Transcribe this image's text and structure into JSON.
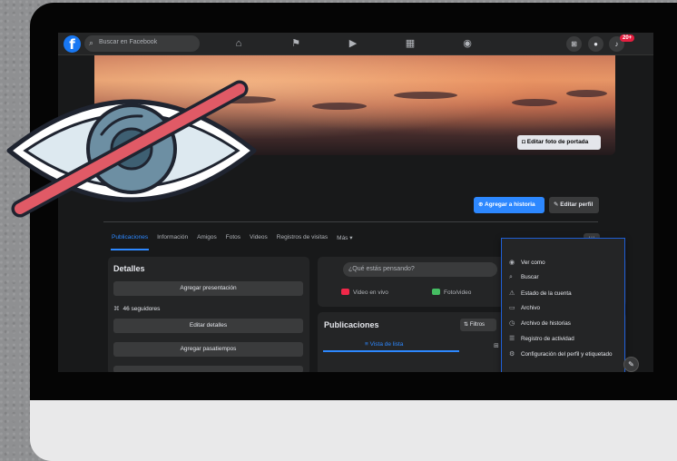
{
  "topbar": {
    "logo_letter": "f",
    "search_placeholder": "Buscar en Facebook",
    "notifications_count": "20+"
  },
  "cover": {
    "edit_cover_label": "Editar foto de portada"
  },
  "profile_actions": {
    "add_story_label": "Agregar a historia",
    "edit_profile_label": "Editar perfil"
  },
  "tabs": [
    {
      "label": "Publicaciones",
      "active": true
    },
    {
      "label": "Información"
    },
    {
      "label": "Amigos"
    },
    {
      "label": "Fotos"
    },
    {
      "label": "Videos"
    },
    {
      "label": "Registros de visitas"
    },
    {
      "label": "Más ▾"
    }
  ],
  "more_button": "···",
  "details": {
    "title": "Detalles",
    "add_bio": "Agregar presentación",
    "followers": "46 seguidores",
    "edit_details": "Editar detalles",
    "add_hobbies": "Agregar pasatiempos"
  },
  "composer": {
    "placeholder": "¿Qué estás pensando?",
    "live_video": "Video en vivo",
    "photo_video": "Foto/video"
  },
  "posts": {
    "title": "Publicaciones",
    "filters": "Filtros",
    "list_view": "Vista de lista"
  },
  "menu": {
    "items": [
      {
        "label": "Ver como",
        "icon": "eye-icon"
      },
      {
        "label": "Buscar",
        "icon": "search-icon"
      },
      {
        "label": "Estado de la cuenta",
        "icon": "warning-icon"
      },
      {
        "label": "Archivo",
        "icon": "archive-icon"
      },
      {
        "label": "Archivo de historias",
        "icon": "history-icon"
      },
      {
        "label": "Registro de actividad",
        "icon": "list-icon"
      },
      {
        "label": "Configuración del perfil y etiquetado",
        "icon": "settings-icon"
      }
    ]
  },
  "colors": {
    "fb_blue": "#1877f2",
    "accent": "#2d88ff",
    "menu_border": "#1f5fd6",
    "slash_red": "#e05a66"
  }
}
